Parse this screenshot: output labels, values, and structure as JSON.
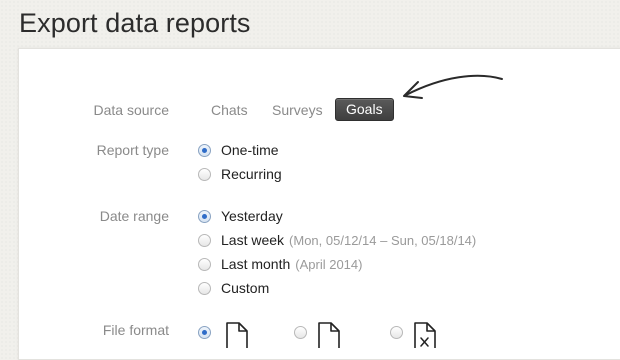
{
  "page": {
    "title": "Export data reports"
  },
  "data_source": {
    "label": "Data source",
    "tabs": [
      {
        "label": "Chats",
        "active": false
      },
      {
        "label": "Surveys",
        "active": false
      },
      {
        "label": "Goals",
        "active": true
      }
    ]
  },
  "report_type": {
    "label": "Report type",
    "options": [
      {
        "label": "One-time",
        "checked": true
      },
      {
        "label": "Recurring",
        "checked": false
      }
    ]
  },
  "date_range": {
    "label": "Date range",
    "options": [
      {
        "label": "Yesterday",
        "note": "",
        "checked": true
      },
      {
        "label": "Last week",
        "note": "(Mon, 05/12/14 – Sun, 05/18/14)",
        "checked": false
      },
      {
        "label": "Last month",
        "note": "(April 2014)",
        "checked": false
      },
      {
        "label": "Custom",
        "note": "",
        "checked": false
      }
    ]
  },
  "file_format": {
    "label": "File format",
    "options": [
      {
        "icon": "csv-file-icon",
        "checked": true
      },
      {
        "icon": "document-file-icon",
        "checked": false
      },
      {
        "icon": "excel-file-icon",
        "checked": false
      }
    ]
  },
  "colors": {
    "background": "#f1f0ec",
    "active_tab": "#474747",
    "radio_accent": "#2f6cc8",
    "label_gray": "#8a8a8a"
  }
}
